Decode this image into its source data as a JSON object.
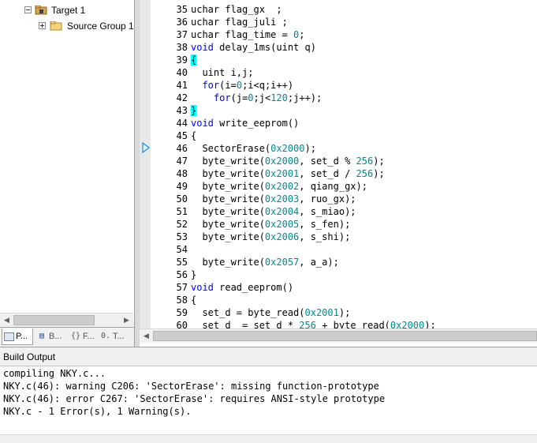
{
  "project_tree": {
    "target_label": "Target 1",
    "source_group_label": "Source Group 1"
  },
  "project_tabs": [
    {
      "label": "P...",
      "icon": "project-icon"
    },
    {
      "label": "B...",
      "icon": "books-icon"
    },
    {
      "label": "F...",
      "icon": "functions-icon"
    },
    {
      "label": "T...",
      "icon": "templates-icon"
    }
  ],
  "editor": {
    "lines": [
      {
        "n": "35",
        "code": [
          {
            "t": "uchar flag_gx  ;"
          }
        ]
      },
      {
        "n": "36",
        "code": [
          {
            "t": "uchar flag_juli ;"
          }
        ]
      },
      {
        "n": "37",
        "code": [
          {
            "t": "uchar flag_time = "
          },
          {
            "t": "0",
            "c": "num"
          },
          {
            "t": ";"
          }
        ]
      },
      {
        "n": "38",
        "code": [
          {
            "t": "void",
            "c": "kw"
          },
          {
            "t": " delay_1ms(uint q)"
          }
        ]
      },
      {
        "n": "39",
        "code": [
          {
            "t": "{",
            "c": "bm"
          }
        ]
      },
      {
        "n": "40",
        "code": [
          {
            "t": "  uint i,j;"
          }
        ]
      },
      {
        "n": "41",
        "code": [
          {
            "t": "  "
          },
          {
            "t": "for",
            "c": "kw"
          },
          {
            "t": "(i="
          },
          {
            "t": "0",
            "c": "num"
          },
          {
            "t": ";i<q;i++)"
          }
        ]
      },
      {
        "n": "42",
        "code": [
          {
            "t": "    "
          },
          {
            "t": "for",
            "c": "kw"
          },
          {
            "t": "(j="
          },
          {
            "t": "0",
            "c": "num"
          },
          {
            "t": ";j<"
          },
          {
            "t": "120",
            "c": "num"
          },
          {
            "t": ";j++);"
          }
        ]
      },
      {
        "n": "43",
        "code": [
          {
            "t": "}",
            "c": "bm"
          }
        ]
      },
      {
        "n": "44",
        "code": [
          {
            "t": "void",
            "c": "kw"
          },
          {
            "t": " write_eeprom()"
          }
        ]
      },
      {
        "n": "45",
        "code": [
          {
            "t": "{"
          }
        ]
      },
      {
        "n": "46",
        "code": [
          {
            "t": "  SectorErase("
          },
          {
            "t": "0x2000",
            "c": "num"
          },
          {
            "t": ");"
          }
        ]
      },
      {
        "n": "47",
        "code": [
          {
            "t": "  byte_write("
          },
          {
            "t": "0x2000",
            "c": "num"
          },
          {
            "t": ", set_d % "
          },
          {
            "t": "256",
            "c": "num"
          },
          {
            "t": ");"
          }
        ]
      },
      {
        "n": "48",
        "code": [
          {
            "t": "  byte_write("
          },
          {
            "t": "0x2001",
            "c": "num"
          },
          {
            "t": ", set_d / "
          },
          {
            "t": "256",
            "c": "num"
          },
          {
            "t": ");"
          }
        ]
      },
      {
        "n": "49",
        "code": [
          {
            "t": "  byte_write("
          },
          {
            "t": "0x2002",
            "c": "num"
          },
          {
            "t": ", qiang_gx);"
          }
        ]
      },
      {
        "n": "50",
        "code": [
          {
            "t": "  byte_write("
          },
          {
            "t": "0x2003",
            "c": "num"
          },
          {
            "t": ", ruo_gx);"
          }
        ]
      },
      {
        "n": "51",
        "code": [
          {
            "t": "  byte_write("
          },
          {
            "t": "0x2004",
            "c": "num"
          },
          {
            "t": ", s_miao);"
          }
        ]
      },
      {
        "n": "52",
        "code": [
          {
            "t": "  byte_write("
          },
          {
            "t": "0x2005",
            "c": "num"
          },
          {
            "t": ", s_fen);"
          }
        ]
      },
      {
        "n": "53",
        "code": [
          {
            "t": "  byte_write("
          },
          {
            "t": "0x2006",
            "c": "num"
          },
          {
            "t": ", s_shi);"
          }
        ]
      },
      {
        "n": "54",
        "code": []
      },
      {
        "n": "55",
        "code": [
          {
            "t": "  byte_write("
          },
          {
            "t": "0x2057",
            "c": "num"
          },
          {
            "t": ", a_a);"
          }
        ]
      },
      {
        "n": "56",
        "code": [
          {
            "t": "}"
          }
        ]
      },
      {
        "n": "57",
        "code": [
          {
            "t": "void",
            "c": "kw"
          },
          {
            "t": " read_eeprom()"
          }
        ]
      },
      {
        "n": "58",
        "code": [
          {
            "t": "{"
          }
        ]
      },
      {
        "n": "59",
        "code": [
          {
            "t": "  set_d = byte_read("
          },
          {
            "t": "0x2001",
            "c": "num"
          },
          {
            "t": ");"
          }
        ]
      },
      {
        "n": "60",
        "code": [
          {
            "t": "  set_d  = set_d * "
          },
          {
            "t": "256",
            "c": "num"
          },
          {
            "t": " + byte_read("
          },
          {
            "t": "0x2000",
            "c": "num"
          },
          {
            "t": ");"
          }
        ]
      }
    ]
  },
  "build_output": {
    "title": "Build Output",
    "lines": [
      "compiling NKY.c...",
      "NKY.c(46): warning C206: 'SectorErase': missing function-prototype",
      "NKY.c(46): error C267: 'SectorErase': requires ANSI-style prototype",
      "NKY.c - 1 Error(s), 1 Warning(s)."
    ]
  },
  "colors": {
    "keyword": "#0000ff",
    "number": "#008b8b",
    "brace_highlight": "#00ffff",
    "gutter": "#e8e8e8",
    "panel_bg": "#f0f0f0"
  }
}
